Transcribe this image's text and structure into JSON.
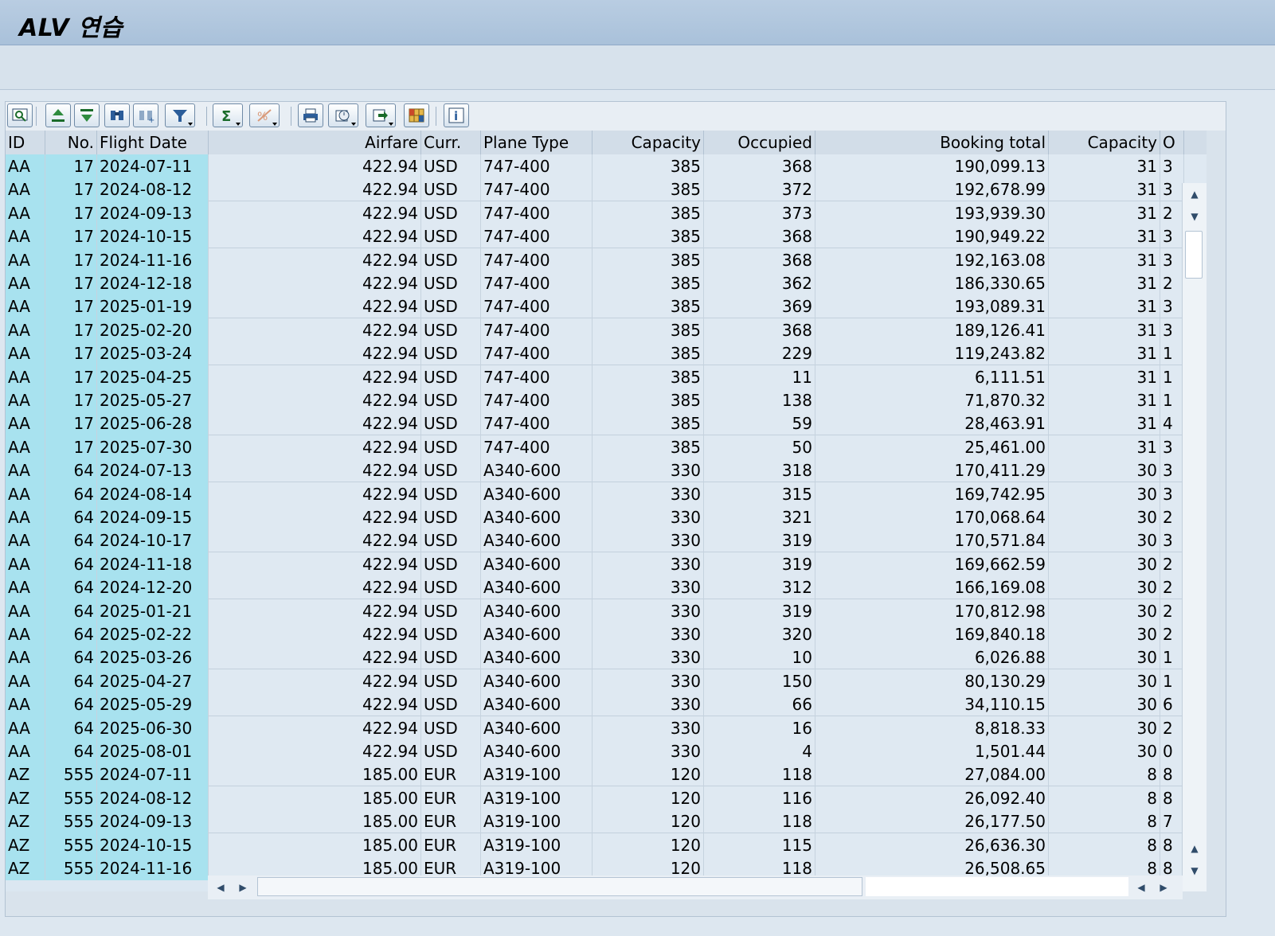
{
  "window": {
    "title": "ALV 연습"
  },
  "toolbar": {
    "buttons": [
      {
        "name": "details-icon"
      },
      {
        "name": "sort-ascending-icon"
      },
      {
        "name": "sort-descending-icon"
      },
      {
        "name": "find-icon"
      },
      {
        "name": "find-next-icon"
      },
      {
        "name": "filter-icon"
      },
      {
        "name": "sum-icon"
      },
      {
        "name": "subtotal-icon"
      },
      {
        "name": "print-icon"
      },
      {
        "name": "views-icon"
      },
      {
        "name": "export-icon"
      },
      {
        "name": "layout-icon"
      },
      {
        "name": "info-icon"
      }
    ]
  },
  "table": {
    "headers": [
      "ID",
      "No.",
      "Flight Date",
      "Airfare",
      "Curr.",
      "Plane Type",
      "Capacity",
      "Occupied",
      "Booking total",
      "Capacity",
      "O"
    ],
    "rows": [
      [
        "AA",
        "17",
        "2024-07-11",
        "422.94",
        "USD",
        "747-400",
        "385",
        "368",
        "190,099.13",
        "31",
        "3"
      ],
      [
        "AA",
        "17",
        "2024-08-12",
        "422.94",
        "USD",
        "747-400",
        "385",
        "372",
        "192,678.99",
        "31",
        "3"
      ],
      [
        "AA",
        "17",
        "2024-09-13",
        "422.94",
        "USD",
        "747-400",
        "385",
        "373",
        "193,939.30",
        "31",
        "2"
      ],
      [
        "AA",
        "17",
        "2024-10-15",
        "422.94",
        "USD",
        "747-400",
        "385",
        "368",
        "190,949.22",
        "31",
        "3"
      ],
      [
        "AA",
        "17",
        "2024-11-16",
        "422.94",
        "USD",
        "747-400",
        "385",
        "368",
        "192,163.08",
        "31",
        "3"
      ],
      [
        "AA",
        "17",
        "2024-12-18",
        "422.94",
        "USD",
        "747-400",
        "385",
        "362",
        "186,330.65",
        "31",
        "2"
      ],
      [
        "AA",
        "17",
        "2025-01-19",
        "422.94",
        "USD",
        "747-400",
        "385",
        "369",
        "193,089.31",
        "31",
        "3"
      ],
      [
        "AA",
        "17",
        "2025-02-20",
        "422.94",
        "USD",
        "747-400",
        "385",
        "368",
        "189,126.41",
        "31",
        "3"
      ],
      [
        "AA",
        "17",
        "2025-03-24",
        "422.94",
        "USD",
        "747-400",
        "385",
        "229",
        "119,243.82",
        "31",
        "1"
      ],
      [
        "AA",
        "17",
        "2025-04-25",
        "422.94",
        "USD",
        "747-400",
        "385",
        "11",
        "6,111.51",
        "31",
        "1"
      ],
      [
        "AA",
        "17",
        "2025-05-27",
        "422.94",
        "USD",
        "747-400",
        "385",
        "138",
        "71,870.32",
        "31",
        "1"
      ],
      [
        "AA",
        "17",
        "2025-06-28",
        "422.94",
        "USD",
        "747-400",
        "385",
        "59",
        "28,463.91",
        "31",
        "4"
      ],
      [
        "AA",
        "17",
        "2025-07-30",
        "422.94",
        "USD",
        "747-400",
        "385",
        "50",
        "25,461.00",
        "31",
        "3"
      ],
      [
        "AA",
        "64",
        "2024-07-13",
        "422.94",
        "USD",
        "A340-600",
        "330",
        "318",
        "170,411.29",
        "30",
        "3"
      ],
      [
        "AA",
        "64",
        "2024-08-14",
        "422.94",
        "USD",
        "A340-600",
        "330",
        "315",
        "169,742.95",
        "30",
        "3"
      ],
      [
        "AA",
        "64",
        "2024-09-15",
        "422.94",
        "USD",
        "A340-600",
        "330",
        "321",
        "170,068.64",
        "30",
        "2"
      ],
      [
        "AA",
        "64",
        "2024-10-17",
        "422.94",
        "USD",
        "A340-600",
        "330",
        "319",
        "170,571.84",
        "30",
        "3"
      ],
      [
        "AA",
        "64",
        "2024-11-18",
        "422.94",
        "USD",
        "A340-600",
        "330",
        "319",
        "169,662.59",
        "30",
        "2"
      ],
      [
        "AA",
        "64",
        "2024-12-20",
        "422.94",
        "USD",
        "A340-600",
        "330",
        "312",
        "166,169.08",
        "30",
        "2"
      ],
      [
        "AA",
        "64",
        "2025-01-21",
        "422.94",
        "USD",
        "A340-600",
        "330",
        "319",
        "170,812.98",
        "30",
        "2"
      ],
      [
        "AA",
        "64",
        "2025-02-22",
        "422.94",
        "USD",
        "A340-600",
        "330",
        "320",
        "169,840.18",
        "30",
        "2"
      ],
      [
        "AA",
        "64",
        "2025-03-26",
        "422.94",
        "USD",
        "A340-600",
        "330",
        "10",
        "6,026.88",
        "30",
        "1"
      ],
      [
        "AA",
        "64",
        "2025-04-27",
        "422.94",
        "USD",
        "A340-600",
        "330",
        "150",
        "80,130.29",
        "30",
        "1"
      ],
      [
        "AA",
        "64",
        "2025-05-29",
        "422.94",
        "USD",
        "A340-600",
        "330",
        "66",
        "34,110.15",
        "30",
        "6"
      ],
      [
        "AA",
        "64",
        "2025-06-30",
        "422.94",
        "USD",
        "A340-600",
        "330",
        "16",
        "8,818.33",
        "30",
        "2"
      ],
      [
        "AA",
        "64",
        "2025-08-01",
        "422.94",
        "USD",
        "A340-600",
        "330",
        "4",
        "1,501.44",
        "30",
        "0"
      ],
      [
        "AZ",
        "555",
        "2024-07-11",
        "185.00",
        "EUR",
        "A319-100",
        "120",
        "118",
        "27,084.00",
        "8",
        "8"
      ],
      [
        "AZ",
        "555",
        "2024-08-12",
        "185.00",
        "EUR",
        "A319-100",
        "120",
        "116",
        "26,092.40",
        "8",
        "8"
      ],
      [
        "AZ",
        "555",
        "2024-09-13",
        "185.00",
        "EUR",
        "A319-100",
        "120",
        "118",
        "26,177.50",
        "8",
        "7"
      ],
      [
        "AZ",
        "555",
        "2024-10-15",
        "185.00",
        "EUR",
        "A319-100",
        "120",
        "115",
        "26,636.30",
        "8",
        "8"
      ],
      [
        "AZ",
        "555",
        "2024-11-16",
        "185.00",
        "EUR",
        "A319-100",
        "120",
        "118",
        "26,508.65",
        "8",
        "8"
      ]
    ]
  },
  "colors": {
    "key_column": "#a8e2ef",
    "row_bg": "#dfe9f2",
    "header_bg": "#d2dde8"
  }
}
